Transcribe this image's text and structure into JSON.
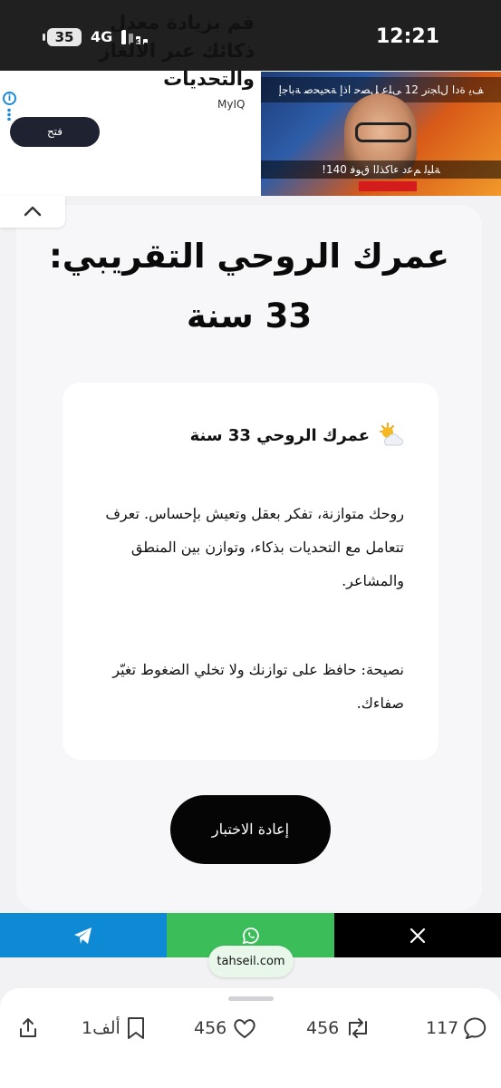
{
  "status_bar": {
    "battery_level": "35",
    "network": "4G",
    "time": "12:21"
  },
  "ad": {
    "headline": "قم بزيادة معدل ذكائك عبر الألغاز والتحديات",
    "brand": "MyIQ",
    "open_label": "فتح",
    "image_top_text": "ﻒﻳ ﺓﺩﺍ ﻝﺎﺠﻧﺭ 12 ﻰﻠﻋ ﻞﺼﺣ ﺍﺫﺇ ﺔﺤﻴﺤﺻ ﺔﺑﺎﺟﺇ",
    "image_bottom_text": "!ﺔﻠﻴﻟ ﻢﻋﺩ ﺀﺎﻛﺬﻟﺍ ﻕﻮﻓ 140"
  },
  "result": {
    "title": "عمرك الروحي التقريبي: 33 سنة",
    "heading": "عمرك الروحي 33 سنة",
    "description": "روحك متوازنة، تفكر بعقل وتعيش بإحساس. تعرف تتعامل مع التحديات بذكاء، وتوازن بين المنطق والمشاعر.",
    "advice": "نصيحة: حافظ على توازنك ولا تخلي الضغوط تغيّر صفاءك.",
    "retry_label": "إعادة الاختبار"
  },
  "share": {
    "site": "tahseil.com",
    "colors": {
      "telegram": "#0e8ad4",
      "whatsapp": "#3bbd5a",
      "x": "#000000"
    }
  },
  "actions": {
    "bookmark_count": "1ألف",
    "like_count": "456",
    "repost_count": "456",
    "reply_count": "117"
  }
}
